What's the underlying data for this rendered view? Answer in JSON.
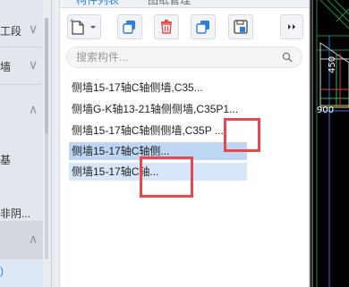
{
  "sidebar": {
    "items": [
      {
        "label": "工段",
        "chevron": "∨"
      },
      {
        "label": "墙",
        "chevron": "∨"
      },
      {
        "label": "",
        "chevron": "∧"
      },
      {
        "label": "基",
        "chevron": ""
      },
      {
        "label": "非阴...",
        "chevron": ""
      },
      {
        "label": "",
        "chevron": "∧"
      },
      {
        "label": ")",
        "chevron": ""
      }
    ]
  },
  "tabs": [
    "构件列表",
    "图纸管理"
  ],
  "toolbar": {
    "buttons": [
      "new-component",
      "dropdown",
      "copy",
      "delete",
      "copy-layer",
      "save-layer",
      "collapse"
    ]
  },
  "search": {
    "placeholder": "搜索构件..."
  },
  "component_list": [
    "侧墙15-17轴C轴侧墙,C35...",
    "侧墙G-K轴13-21轴侧侧墙,C35P1...",
    "侧墙15-17轴C轴侧侧墙,C35P ...",
    "侧墙15-17轴C轴侧...",
    "侧墙15-17轴C轴..."
  ],
  "canvas": {
    "label_a": "450",
    "label_b": "900"
  },
  "colors": {
    "accent": "#2f7de1",
    "highlight_red": "#e8484d",
    "selected_bg": "#bcd6f3"
  }
}
